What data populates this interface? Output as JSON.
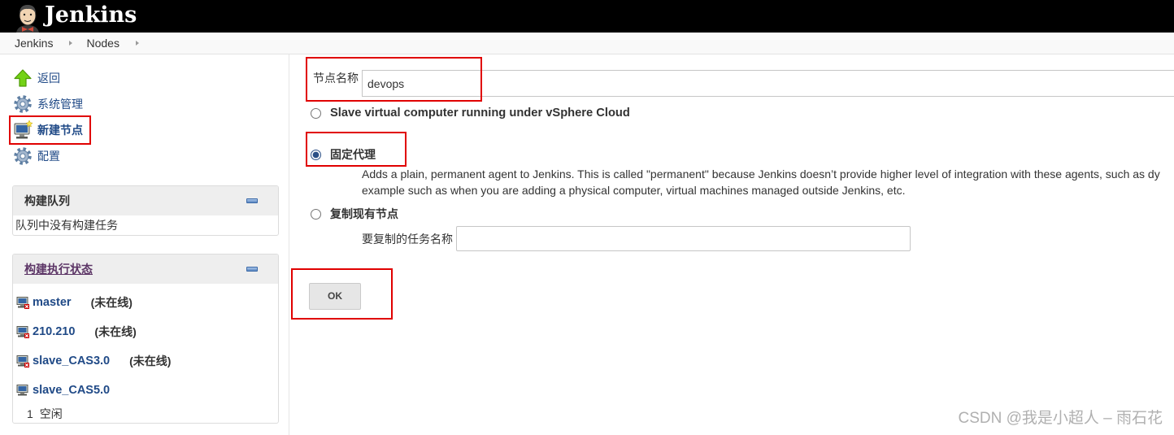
{
  "colors": {
    "header_bg": "#000000",
    "link": "#204a87",
    "visited_link": "#5c3566",
    "annotation": "#e00000",
    "text": "#333333",
    "offline_badge": "#cc0000"
  },
  "header": {
    "title": "Jenkins",
    "logo_icon": "jenkins-butler-icon"
  },
  "breadcrumb": {
    "items": [
      {
        "label": "Jenkins"
      },
      {
        "label": "Nodes"
      }
    ],
    "separator_icon": "breadcrumb-arrow-icon"
  },
  "sidebar": {
    "tasks": [
      {
        "label": "返回",
        "icon": "up-arrow-icon"
      },
      {
        "label": "系统管理",
        "icon": "gear-icon"
      },
      {
        "label": "新建节点",
        "icon": "new-computer-icon"
      },
      {
        "label": "配置",
        "icon": "gear-icon"
      }
    ],
    "build_queue": {
      "title": "构建队列",
      "empty_message": "队列中没有构建任务",
      "collapse_icon": "collapse-icon"
    },
    "executor_status": {
      "title": "构建执行状态",
      "collapse_icon": "collapse-icon",
      "nodes": [
        {
          "name": "master",
          "status": "(未在线)",
          "offline": true,
          "icon": "computer-offline-icon"
        },
        {
          "name": "210.210",
          "status": "(未在线)",
          "offline": true,
          "icon": "computer-offline-icon"
        },
        {
          "name": "slave_CAS3.0",
          "status": "(未在线)",
          "offline": true,
          "icon": "computer-offline-icon"
        },
        {
          "name": "slave_CAS5.0",
          "offline": false,
          "icon": "computer-icon",
          "executors": [
            {
              "number": "1",
              "state": "空闲"
            }
          ]
        }
      ]
    }
  },
  "form": {
    "node_name": {
      "label": "节点名称",
      "value": "devops"
    },
    "node_types": [
      {
        "label": "Slave virtual computer running under vSphere Cloud",
        "selected": false
      },
      {
        "label": "固定代理",
        "selected": true,
        "description_lines": [
          "Adds a plain, permanent agent to Jenkins. This is called \"permanent\" because Jenkins doesn’t provide higher level of integration with these agents, such as dy",
          "example such as when you are adding a physical computer, virtual machines managed outside Jenkins, etc."
        ]
      },
      {
        "label": "复制现有节点",
        "selected": false,
        "copy_from_label": "要复制的任务名称"
      }
    ],
    "ok_button": {
      "label": "OK"
    }
  },
  "watermark": {
    "text": "CSDN @我是小超人 – 雨石花"
  }
}
